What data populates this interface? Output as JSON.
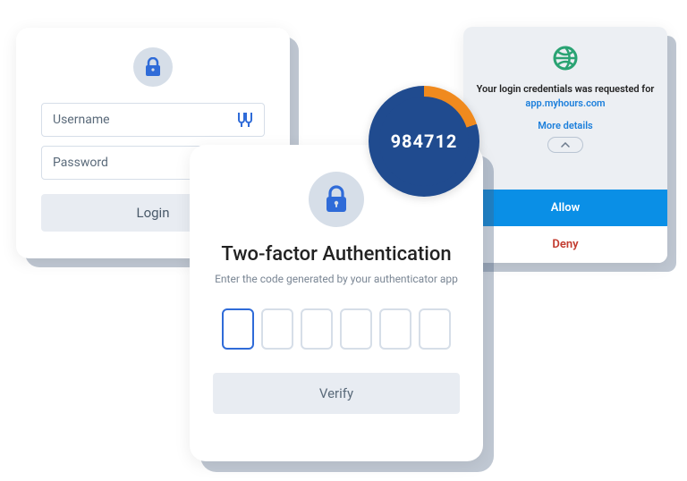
{
  "login": {
    "username_placeholder": "Username",
    "password_placeholder": "Password",
    "login_label": "Login"
  },
  "approval": {
    "message_prefix": "Your login credentials was requested for ",
    "app_domain": "app.myhours.com",
    "more_details_label": "More details",
    "allow_label": "Allow",
    "deny_label": "Deny"
  },
  "twofactor": {
    "title": "Two-factor Authentication",
    "subtitle": "Enter the code generated by your authenticator app",
    "verify_label": "Verify"
  },
  "token": {
    "code": "984712"
  },
  "colors": {
    "accent_blue": "#2f6bd8",
    "brand_blue": "#0a8fe6",
    "ring_dark": "#204b8f",
    "ring_orange": "#f08a1e",
    "deny_red": "#c23a2e",
    "globe_green": "#2aa373"
  }
}
